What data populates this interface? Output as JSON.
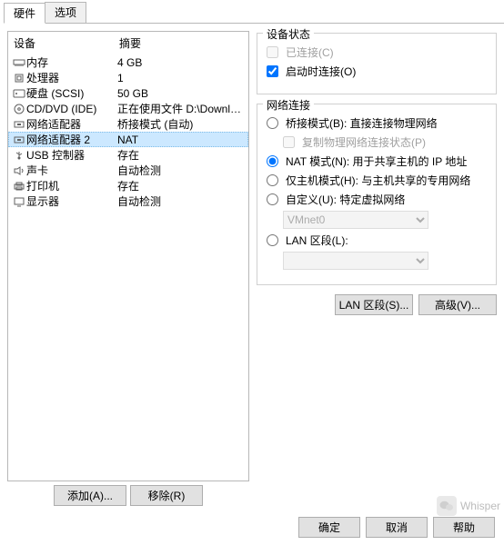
{
  "tabs": {
    "hardware": "硬件",
    "options": "选项"
  },
  "left": {
    "header_device": "设备",
    "header_summary": "摘要",
    "rows": [
      {
        "icon": "mem",
        "label": "内存",
        "summary": "4 GB"
      },
      {
        "icon": "cpu",
        "label": "处理器",
        "summary": "1"
      },
      {
        "icon": "hdd",
        "label": "硬盘 (SCSI)",
        "summary": "50 GB"
      },
      {
        "icon": "cd",
        "label": "CD/DVD (IDE)",
        "summary": "正在使用文件 D:\\Download\\Ku..."
      },
      {
        "icon": "net",
        "label": "网络适配器",
        "summary": "桥接模式 (自动)"
      },
      {
        "icon": "net",
        "label": "网络适配器 2",
        "summary": "NAT"
      },
      {
        "icon": "usb",
        "label": "USB 控制器",
        "summary": "存在"
      },
      {
        "icon": "snd",
        "label": "声卡",
        "summary": "自动检测"
      },
      {
        "icon": "prn",
        "label": "打印机",
        "summary": "存在"
      },
      {
        "icon": "mon",
        "label": "显示器",
        "summary": "自动检测"
      }
    ],
    "add_btn": "添加(A)...",
    "remove_btn": "移除(R)"
  },
  "right": {
    "status_title": "设备状态",
    "connected": "已连接(C)",
    "connect_at_poweron": "启动时连接(O)",
    "netconn_title": "网络连接",
    "opt_bridge": "桥接模式(B): 直接连接物理网络",
    "opt_bridge_copy": "复制物理网络连接状态(P)",
    "opt_nat": "NAT 模式(N): 用于共享主机的 IP 地址",
    "opt_host": "仅主机模式(H): 与主机共享的专用网络",
    "opt_custom": "自定义(U): 特定虚拟网络",
    "custom_value": "VMnet0",
    "opt_lan": "LAN 区段(L):",
    "btn_lan": "LAN 区段(S)...",
    "btn_adv": "高级(V)..."
  },
  "footer": {
    "ok": "确定",
    "cancel": "取消",
    "help": "帮助"
  },
  "watermark": "Whisper"
}
